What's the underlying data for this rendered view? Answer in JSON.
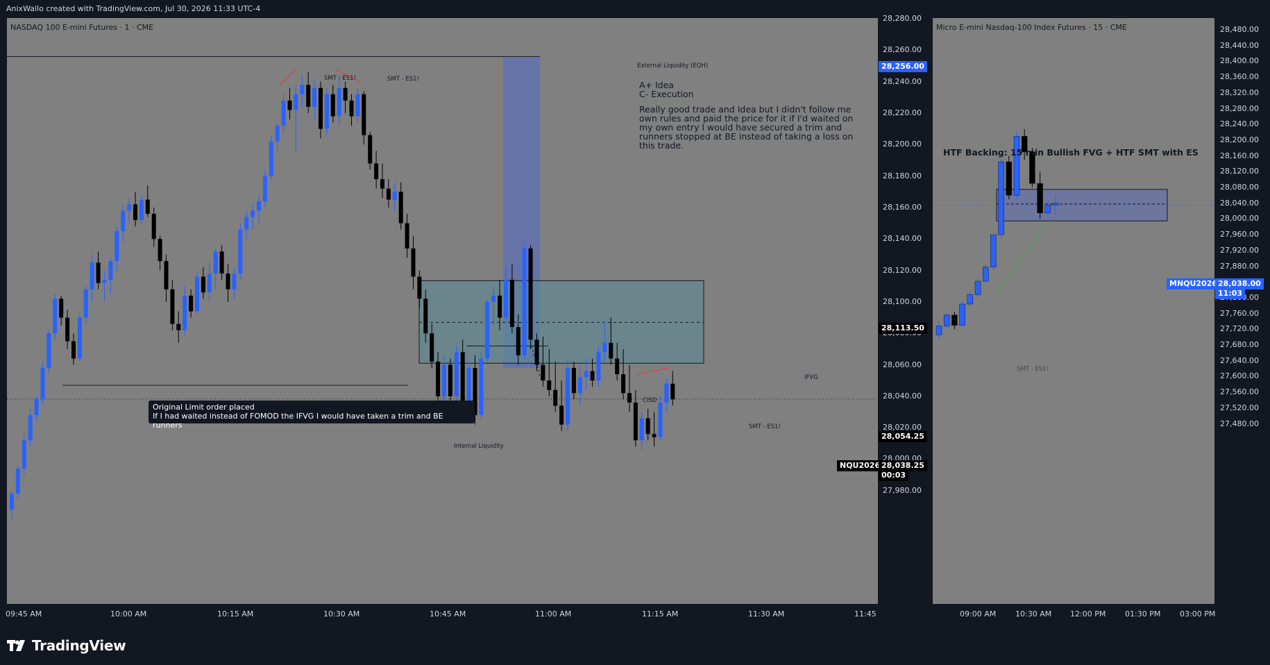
{
  "header": {
    "text": "AnixWallo created with TradingView.com, Jul 30, 2026 11:33 UTC-4"
  },
  "left_chart": {
    "symbol_title": "NASDAQ 100 E-mini Futures · 1 · CME",
    "price_labels": [
      "28,280.00",
      "28,260.00",
      "28,240.00",
      "28,220.00",
      "28,200.00",
      "28,180.00",
      "28,160.00",
      "28,140.00",
      "28,120.00",
      "28,100.00",
      "28,080.00",
      "28,060.00",
      "28,040.00",
      "28,020.00",
      "28,000.00",
      "27,980.00"
    ],
    "time_labels": [
      "09:45 AM",
      "10:00 AM",
      "10:15 AM",
      "10:30 AM",
      "10:45 AM",
      "11:00 AM",
      "11:15 AM",
      "11:30 AM",
      "11:45"
    ],
    "tags": {
      "eqh_price": "28,256.00",
      "mid_price": "28,113.50",
      "low_price": "28,054.25",
      "symbol": "NQU2026",
      "last_price": "28,038.25",
      "countdown": "00:03"
    },
    "annotations": {
      "external_liquidity": "External Liquidity (EQH)",
      "smt_1": "SMT - ES1!",
      "smt_2": "SMT - ES1!",
      "smt_3": "SMT - ES1!",
      "ifvg": "IFVG",
      "cisd": "CISD",
      "internal_liquidity": "Internal Liquidity",
      "callout_line1": "Original Limit order placed",
      "callout_line2": "If I had waited instead of FOMOD the IFVG I would have taken a trim and BE runners",
      "note_title1": "A+ Idea",
      "note_title2": "C- Execution",
      "note_body": [
        "Really good trade and Idea but I didn't follow me",
        "own rules and paid the price for it if I'd waited on",
        "my own entry I would have secured a trim and",
        "runners stopped at BE instead of taking a loss on",
        "this trade."
      ]
    }
  },
  "right_chart": {
    "symbol_title": "Micro E-mini Nasdaq-100 Index Futures · 15 · CME",
    "price_labels": [
      "28,480.00",
      "28,440.00",
      "28,400.00",
      "28,360.00",
      "28,320.00",
      "28,280.00",
      "28,240.00",
      "28,200.00",
      "28,160.00",
      "28,120.00",
      "28,080.00",
      "28,040.00",
      "28,000.00",
      "27,960.00",
      "27,920.00",
      "27,880.00",
      "27,840.00",
      "27,800.00",
      "27,760.00",
      "27,720.00",
      "27,680.00",
      "27,640.00",
      "27,600.00",
      "27,560.00",
      "27,520.00",
      "27,480.00"
    ],
    "time_labels": [
      "09:00 AM",
      "10:30 AM",
      "12:00 PM",
      "01:30 PM",
      "03:00 PM"
    ],
    "tags": {
      "symbol": "MNQU2026",
      "last_price": "28,038.00",
      "countdown": "11:03"
    },
    "annotations": {
      "htf": "HTF Backing: 15 min Bullish FVG + HTF SMT with ES",
      "smt": "SMT - ES1!"
    }
  },
  "footer": {
    "logo": "TradingView"
  },
  "colors": {
    "bg": "#131722",
    "pane": "#808080",
    "bull": "#2962ff",
    "bear": "#000000",
    "ifvg_box": "#5b8a94",
    "blue_zone": "#5c6fb5"
  },
  "chart_data": [
    {
      "type": "candlestick",
      "title": "NASDAQ 100 E-mini Futures · 1 · CME",
      "ylim": [
        27960,
        28285
      ],
      "candles": [
        [
          27968,
          27980,
          27962,
          27978
        ],
        [
          27978,
          27996,
          27975,
          27994
        ],
        [
          27994,
          28016,
          27990,
          28012
        ],
        [
          28012,
          28032,
          28008,
          28028
        ],
        [
          28028,
          28040,
          28024,
          28038
        ],
        [
          28038,
          28062,
          28035,
          28058
        ],
        [
          28058,
          28082,
          28055,
          28080
        ],
        [
          28080,
          28105,
          28076,
          28102
        ],
        [
          28102,
          28104,
          28085,
          28090
        ],
        [
          28090,
          28095,
          28070,
          28075
        ],
        [
          28075,
          28080,
          28060,
          28064
        ],
        [
          28064,
          28094,
          28062,
          28090
        ],
        [
          28090,
          28110,
          28085,
          28108
        ],
        [
          28108,
          28130,
          28100,
          28125
        ],
        [
          28125,
          28132,
          28108,
          28112
        ],
        [
          28112,
          28120,
          28100,
          28114
        ],
        [
          28114,
          28128,
          28105,
          28126
        ],
        [
          28126,
          28148,
          28120,
          28145
        ],
        [
          28145,
          28162,
          28138,
          28158
        ],
        [
          28158,
          28166,
          28150,
          28162
        ],
        [
          28162,
          28170,
          28148,
          28152
        ],
        [
          28152,
          28168,
          28150,
          28165
        ],
        [
          28165,
          28174,
          28154,
          28156
        ],
        [
          28156,
          28160,
          28135,
          28140
        ],
        [
          28140,
          28142,
          28120,
          28126
        ],
        [
          28126,
          28130,
          28100,
          28108
        ],
        [
          28108,
          28114,
          28082,
          28086
        ],
        [
          28086,
          28094,
          28074,
          28082
        ],
        [
          28082,
          28110,
          28078,
          28104
        ],
        [
          28104,
          28108,
          28090,
          28094
        ],
        [
          28094,
          28120,
          28092,
          28116
        ],
        [
          28116,
          28122,
          28102,
          28106
        ],
        [
          28106,
          28125,
          28100,
          28118
        ],
        [
          28118,
          28134,
          28108,
          28132
        ],
        [
          28132,
          28136,
          28114,
          28118
        ],
        [
          28118,
          28124,
          28100,
          28108
        ],
        [
          28108,
          28122,
          28102,
          28118
        ],
        [
          28118,
          28150,
          28114,
          28146
        ],
        [
          28146,
          28158,
          28140,
          28154
        ],
        [
          28154,
          28162,
          28146,
          28158
        ],
        [
          28158,
          28168,
          28150,
          28164
        ],
        [
          28164,
          28184,
          28160,
          28180
        ],
        [
          28180,
          28206,
          28178,
          28202
        ],
        [
          28202,
          28214,
          28196,
          28212
        ],
        [
          28212,
          28232,
          28208,
          28228
        ],
        [
          28228,
          28236,
          28216,
          28222
        ],
        [
          28222,
          28238,
          28196,
          28232
        ],
        [
          28232,
          28244,
          28224,
          28238
        ],
        [
          28238,
          28246,
          28220,
          28224
        ],
        [
          28224,
          28242,
          28216,
          28236
        ],
        [
          28236,
          28240,
          28204,
          28210
        ],
        [
          28210,
          28236,
          28206,
          28232
        ],
        [
          28232,
          28238,
          28214,
          28218
        ],
        [
          28218,
          28244,
          28212,
          28236
        ],
        [
          28236,
          28240,
          28220,
          28228
        ],
        [
          28228,
          28232,
          28212,
          28218
        ],
        [
          28218,
          28236,
          28214,
          28232
        ],
        [
          28232,
          28234,
          28200,
          28206
        ],
        [
          28206,
          28208,
          28184,
          28188
        ],
        [
          28188,
          28196,
          28172,
          28178
        ],
        [
          28178,
          28188,
          28166,
          28172
        ],
        [
          28172,
          28178,
          28160,
          28165
        ],
        [
          28165,
          28176,
          28158,
          28170
        ],
        [
          28170,
          28176,
          28146,
          28150
        ],
        [
          28150,
          28156,
          28128,
          28134
        ],
        [
          28134,
          28142,
          28108,
          28116
        ],
        [
          28116,
          28120,
          28096,
          28102
        ],
        [
          28102,
          28108,
          28074,
          28080
        ],
        [
          28080,
          28086,
          28058,
          28062
        ],
        [
          28062,
          28068,
          28034,
          28040
        ],
        [
          28040,
          28066,
          28034,
          28060
        ],
        [
          28060,
          28064,
          28036,
          28040
        ],
        [
          28040,
          28072,
          28036,
          28068
        ],
        [
          28068,
          28076,
          28024,
          28030
        ],
        [
          28030,
          28062,
          28026,
          28058
        ],
        [
          28058,
          28066,
          28022,
          28028
        ],
        [
          28028,
          28068,
          28026,
          28064
        ],
        [
          28064,
          28102,
          28062,
          28100
        ],
        [
          28100,
          28110,
          28084,
          28104
        ],
        [
          28104,
          28114,
          28082,
          28090
        ],
        [
          28090,
          28122,
          28086,
          28114
        ],
        [
          28114,
          28124,
          28080,
          28084
        ],
        [
          28084,
          28092,
          28060,
          28066
        ],
        [
          28066,
          28138,
          28064,
          28134
        ],
        [
          28134,
          28136,
          28070,
          28076
        ],
        [
          28076,
          28080,
          28056,
          28060
        ],
        [
          28060,
          28078,
          28046,
          28050
        ],
        [
          28050,
          28070,
          28040,
          28044
        ],
        [
          28044,
          28062,
          28030,
          28034
        ],
        [
          28034,
          28050,
          28018,
          28022
        ],
        [
          28022,
          28064,
          28018,
          28058
        ],
        [
          28058,
          28062,
          28038,
          28042
        ],
        [
          28042,
          28060,
          28034,
          28052
        ],
        [
          28052,
          28064,
          28044,
          28056
        ],
        [
          28056,
          28064,
          28046,
          28050
        ],
        [
          28050,
          28072,
          28046,
          28068
        ],
        [
          28068,
          28088,
          28062,
          28074
        ],
        [
          28074,
          28090,
          28060,
          28064
        ],
        [
          28064,
          28074,
          28050,
          28054
        ],
        [
          28054,
          28070,
          28038,
          28042
        ],
        [
          28042,
          28060,
          28030,
          28036
        ],
        [
          28036,
          28044,
          28008,
          28012
        ],
        [
          28012,
          28030,
          28006,
          28026
        ],
        [
          28026,
          28032,
          28012,
          28016
        ],
        [
          28016,
          28030,
          28008,
          28014
        ],
        [
          28014,
          28040,
          28012,
          28036
        ],
        [
          28036,
          28052,
          28030,
          28048
        ],
        [
          28048,
          28056,
          28034,
          28038
        ]
      ],
      "levels": {
        "eqh": 28256,
        "internal_liquidity": 28054.25,
        "last": 28038.25,
        "ifvg_top": 28113.5,
        "ifvg_bottom": 28061,
        "ifvg_mid": 28087
      }
    },
    {
      "type": "candlestick",
      "title": "Micro E-mini Nasdaq-100 Index Futures · 15 · CME",
      "ylim": [
        27470,
        28500
      ],
      "candles": [
        [
          27706,
          27740,
          27695,
          27728
        ],
        [
          27728,
          27762,
          27720,
          27756
        ],
        [
          27756,
          27764,
          27720,
          27730
        ],
        [
          27730,
          27790,
          27726,
          27784
        ],
        [
          27784,
          27816,
          27778,
          27808
        ],
        [
          27808,
          27850,
          27800,
          27842
        ],
        [
          27842,
          27884,
          27838,
          27878
        ],
        [
          27878,
          27960,
          27870,
          27960
        ],
        [
          27960,
          28152,
          27950,
          28145
        ],
        [
          28145,
          28160,
          28050,
          28060
        ],
        [
          28060,
          28222,
          28050,
          28210
        ],
        [
          28210,
          28228,
          28150,
          28170
        ],
        [
          28170,
          28180,
          28080,
          28090
        ],
        [
          28090,
          28120,
          28000,
          28015
        ],
        [
          28015,
          28050,
          28010,
          28035
        ],
        [
          28035,
          28062,
          28010,
          28040
        ]
      ],
      "levels": {
        "fvg_top": 28075,
        "fvg_bottom": 27995,
        "last": 28038
      }
    }
  ]
}
